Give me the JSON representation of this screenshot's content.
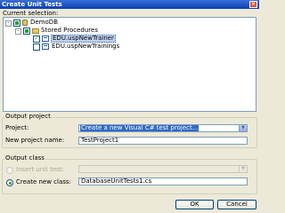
{
  "window": {
    "title": "Create Unit Tests",
    "close_glyph": "×"
  },
  "current_selection": {
    "label": "Current selection:",
    "tree": [
      {
        "text": "DemoDB",
        "expander": "-",
        "checked": "partial",
        "icon": "database-icon"
      },
      {
        "text": "Stored Procedures",
        "expander": "-",
        "checked": "partial",
        "icon": "folder-icon"
      },
      {
        "text": "EDU.uspNewTrainer",
        "checked": "checked",
        "check_glyph": "✓",
        "icon": "stored-procedure-icon",
        "selected": true
      },
      {
        "text": "EDU.uspNewTrainings",
        "checked": "unchecked",
        "icon": "stored-procedure-icon"
      }
    ]
  },
  "output_project": {
    "group_title": "Output project",
    "project_label": "Project:",
    "project_value": "Create a new Visual C# test project...",
    "dropdown_glyph": "▼",
    "new_project_label": "New project name:",
    "new_project_value": "TestProject1"
  },
  "output_class": {
    "group_title": "Output class",
    "insert_label": "Insert unit test:",
    "insert_value": "",
    "create_label": "Create new class:",
    "create_value": "DatabaseUnitTests1.cs",
    "selected_option": "create"
  },
  "buttons": {
    "ok": "OK",
    "cancel": "Cancel"
  },
  "colors": {
    "titlebar": "#0a3fb4",
    "dialog_bg": "#ece9d8",
    "selection": "#316ac5",
    "check": "#21a121"
  }
}
